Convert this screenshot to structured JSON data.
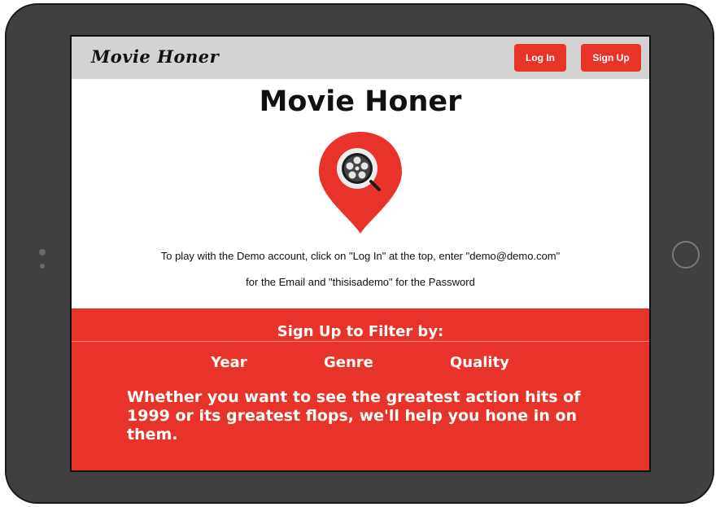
{
  "navbar": {
    "brand": "Movie Honer",
    "login_label": "Log In",
    "signup_label": "Sign Up"
  },
  "main": {
    "title": "Movie Honer",
    "logo_icon": "film-reel-map-pin-icon",
    "demo_line_1": "To play with the Demo account, click on \"Log In\" at the top, enter \"demo@demo.com\"",
    "demo_line_2": "for the Email and \"thisisademo\" for the Password"
  },
  "promo": {
    "heading": "Sign Up to Filter by:",
    "filters": [
      "Year",
      "Genre",
      "Quality"
    ],
    "body": "Whether you want to see the greatest action hits of 1999 or its greatest flops, we'll help you hone in on them."
  },
  "colors": {
    "accent": "#e8332a",
    "navbar_bg": "#d3d3d3",
    "device_frame": "#404040"
  }
}
